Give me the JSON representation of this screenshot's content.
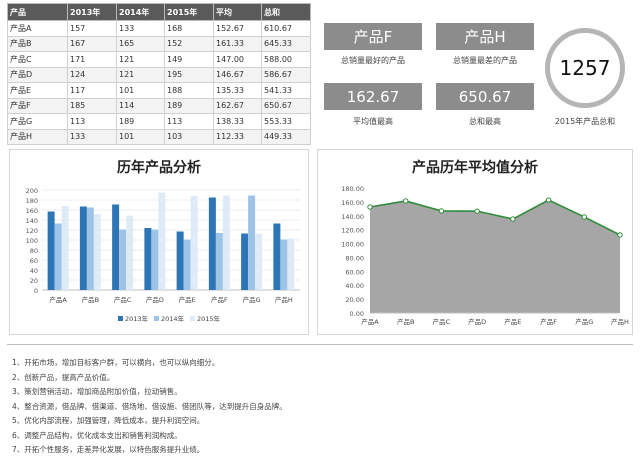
{
  "table": {
    "headers": [
      "产品",
      "2013年",
      "2014年",
      "2015年",
      "平均",
      "总和"
    ],
    "rows": [
      [
        "产品A",
        "157",
        "133",
        "168",
        "152.67",
        "610.67"
      ],
      [
        "产品B",
        "167",
        "165",
        "152",
        "161.33",
        "645.33"
      ],
      [
        "产品C",
        "171",
        "121",
        "149",
        "147.00",
        "588.00"
      ],
      [
        "产品D",
        "124",
        "121",
        "195",
        "146.67",
        "586.67"
      ],
      [
        "产品E",
        "117",
        "101",
        "188",
        "135.33",
        "541.33"
      ],
      [
        "产品F",
        "185",
        "114",
        "189",
        "162.67",
        "650.67"
      ],
      [
        "产品G",
        "113",
        "189",
        "113",
        "138.33",
        "553.33"
      ],
      [
        "产品H",
        "133",
        "101",
        "103",
        "112.33",
        "449.33"
      ]
    ]
  },
  "kpis": {
    "best_product": {
      "value": "产品F",
      "label": "总销量最好的产品"
    },
    "worst_product": {
      "value": "产品H",
      "label": "总销量最差的产品"
    },
    "max_avg": {
      "value": "162.67",
      "label": "平均值最高"
    },
    "max_total": {
      "value": "650.67",
      "label": "总和最高"
    },
    "total_2015": {
      "value": "1257",
      "label": "2015年产品总和"
    }
  },
  "chart_data": [
    {
      "type": "bar",
      "title": "历年产品分析",
      "categories": [
        "产品A",
        "产品B",
        "产品C",
        "产品D",
        "产品E",
        "产品F",
        "产品G",
        "产品H"
      ],
      "series": [
        {
          "name": "2013年",
          "values": [
            157,
            167,
            171,
            124,
            117,
            185,
            113,
            133
          ]
        },
        {
          "name": "2014年",
          "values": [
            133,
            165,
            121,
            121,
            101,
            114,
            189,
            101
          ]
        },
        {
          "name": "2015年",
          "values": [
            168,
            152,
            149,
            195,
            188,
            189,
            113,
            103
          ]
        }
      ],
      "ylim": [
        0,
        200
      ],
      "yticks": [
        0,
        20,
        40,
        60,
        80,
        100,
        120,
        140,
        160,
        180,
        200
      ],
      "legend": "bottom",
      "colors": [
        "#2e75b6",
        "#9dc3e6",
        "#deebf7"
      ]
    },
    {
      "type": "area",
      "title": "产品历年平均值分析",
      "categories": [
        "产品A",
        "产品B",
        "产品C",
        "产品D",
        "产品E",
        "产品F",
        "产品G",
        "产品H"
      ],
      "values": [
        152.67,
        161.33,
        147.0,
        146.67,
        135.33,
        162.67,
        138.33,
        112.33
      ],
      "ylim": [
        0,
        180
      ],
      "yticks": [
        "0.00",
        "20.00",
        "40.00",
        "60.00",
        "80.00",
        "100.00",
        "120.00",
        "140.00",
        "160.00",
        "180.00"
      ],
      "fill_color": "#a6a6a6",
      "line_color": "#2e8b3a"
    }
  ],
  "notes": [
    "1、开拓市场，增加目标客户群，可以横向，也可以纵向细分。",
    "2、创新产品，提高产品价值。",
    "3、策划营销活动，增加商品附加价值，拉动销售。",
    "4、整合资源，借品牌、借渠道、借场地、借设施、借团队等，达到提升自身品牌。",
    "5、优化内部流程，加强管理，降低成本，提升利润空间。",
    "6、调整产品结构，优化成本支出和销售利润构成。",
    "7、开拓个性服务，走差异化发展，以特色服务提升业绩。"
  ]
}
